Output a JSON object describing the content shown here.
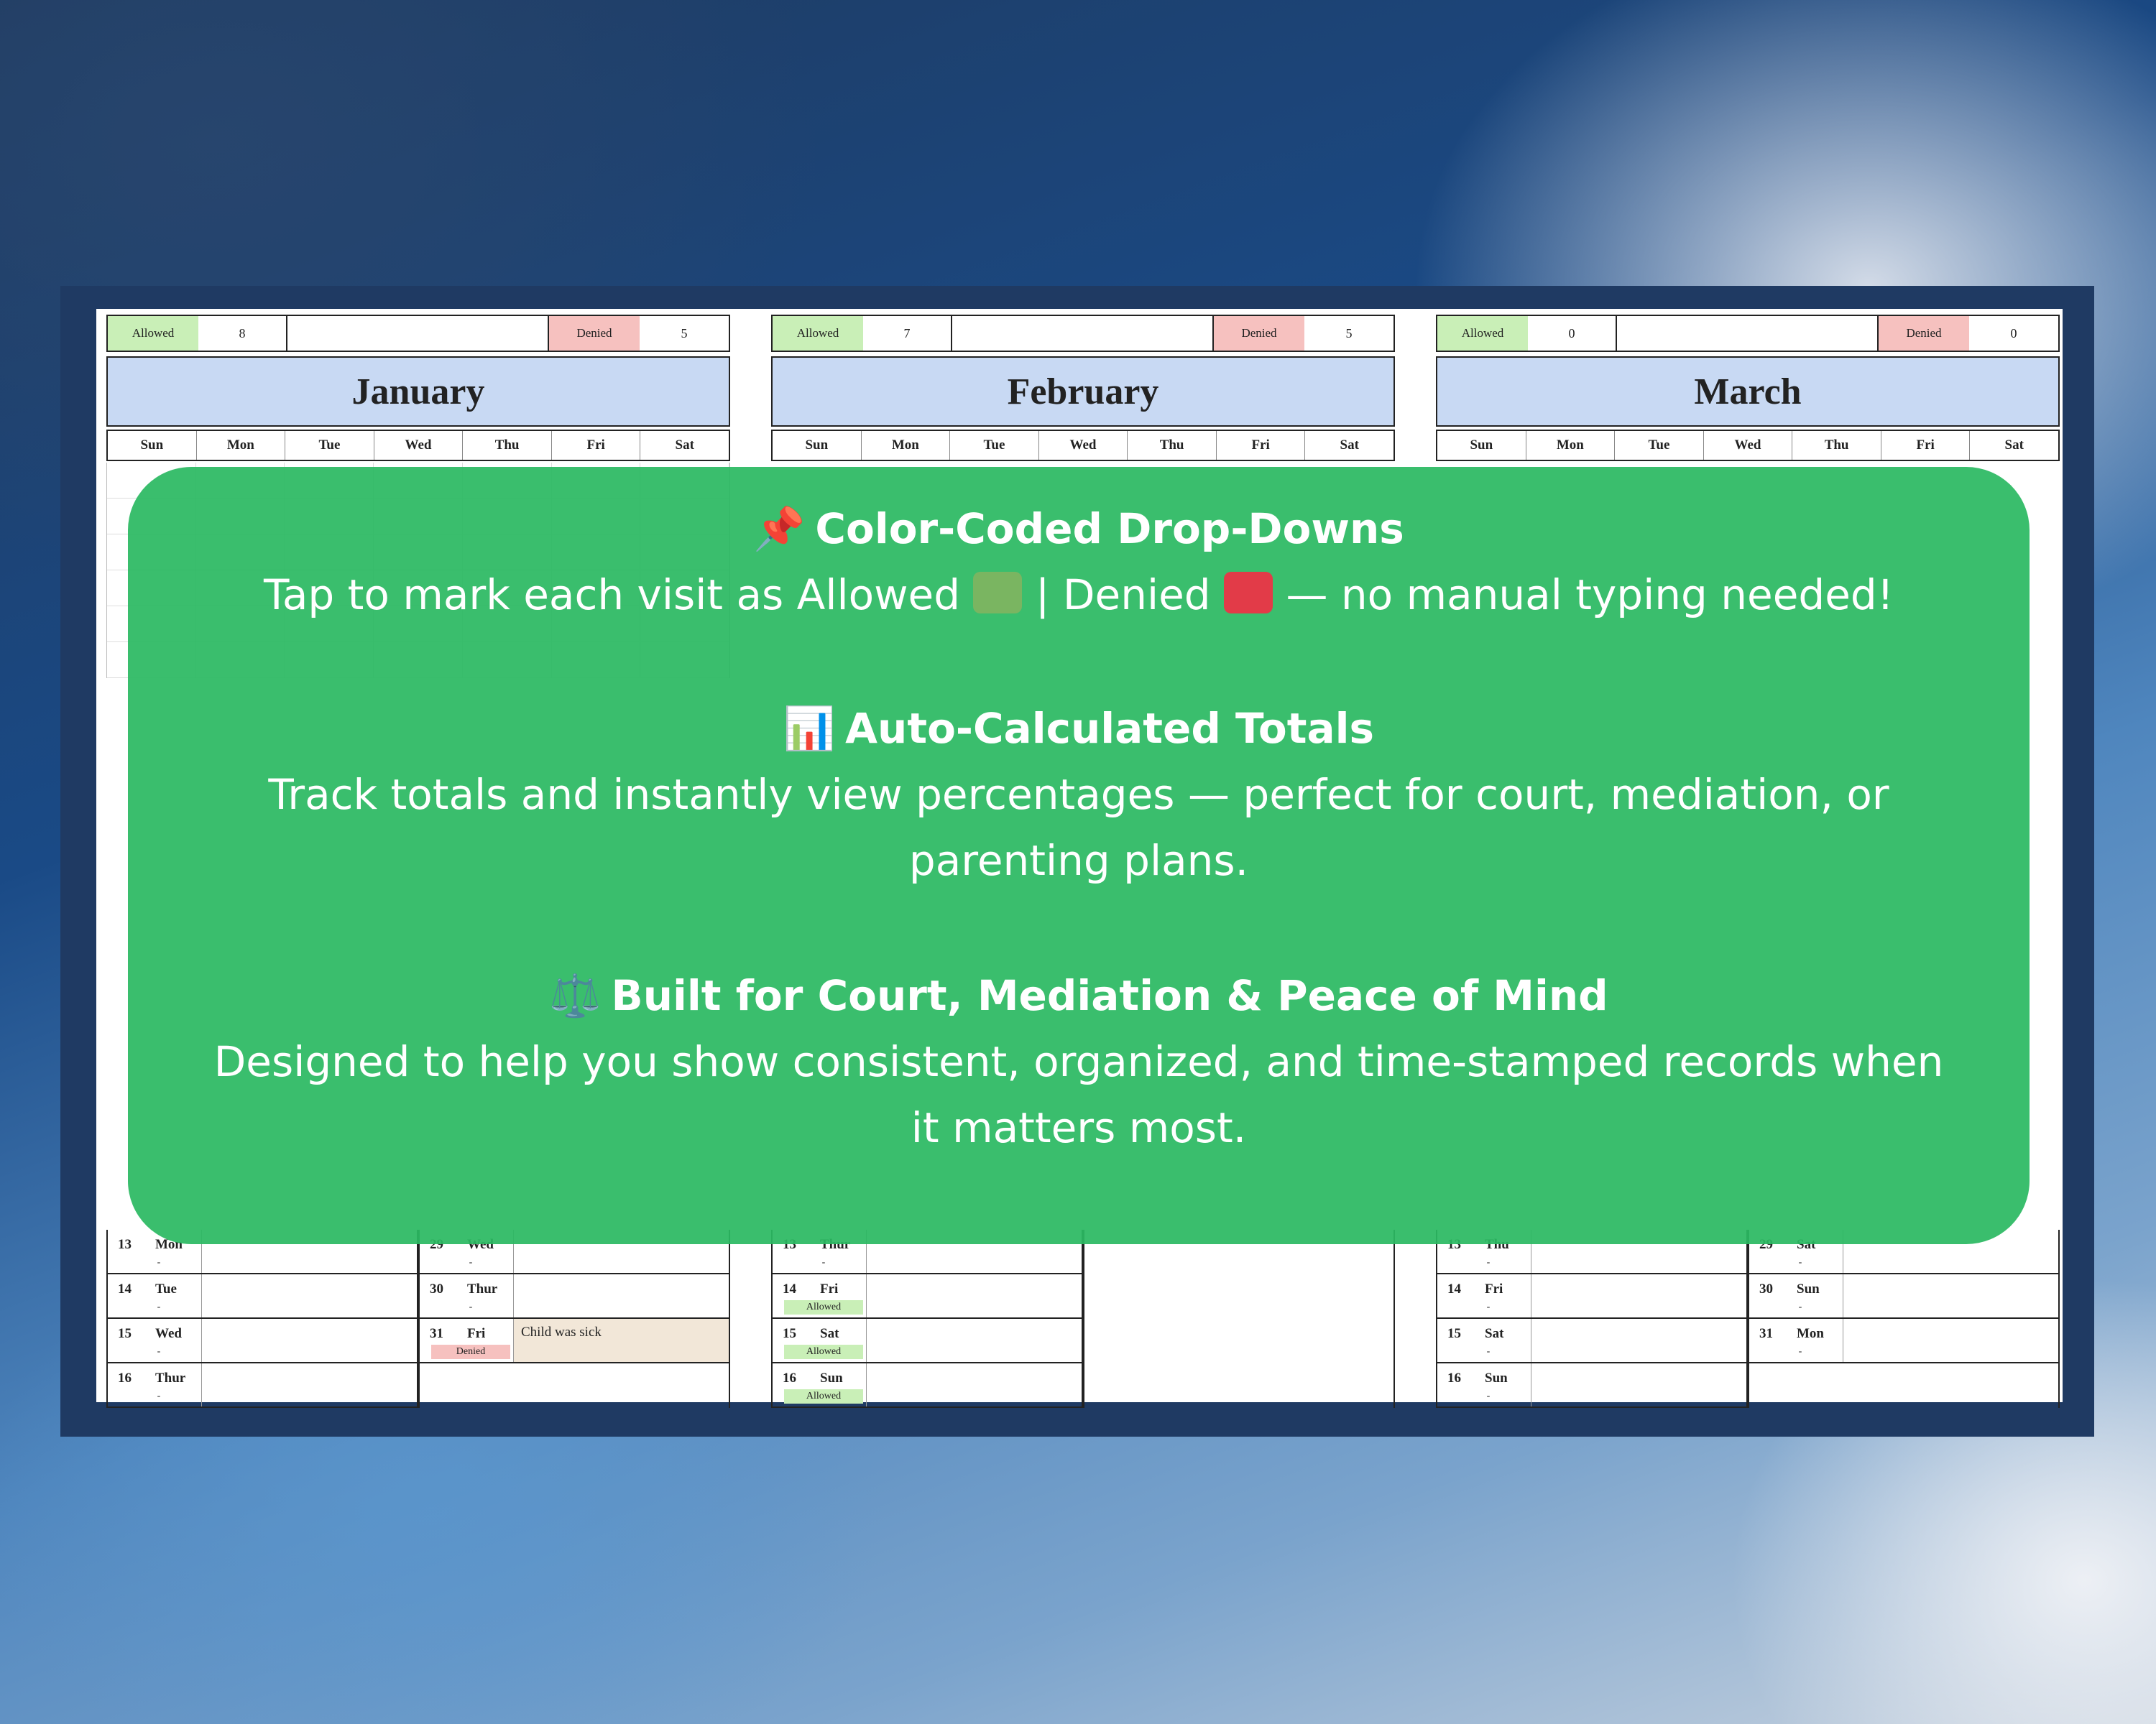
{
  "months": [
    {
      "name": "January",
      "allowed_label": "Allowed",
      "allowed_count": "8",
      "denied_label": "Denied",
      "denied_count": "5"
    },
    {
      "name": "February",
      "allowed_label": "Allowed",
      "allowed_count": "7",
      "denied_label": "Denied",
      "denied_count": "5"
    },
    {
      "name": "March",
      "allowed_label": "Allowed",
      "allowed_count": "0",
      "denied_label": "Denied",
      "denied_count": "0"
    }
  ],
  "weekdays": [
    "Sun",
    "Mon",
    "Tue",
    "Wed",
    "Thu",
    "Fri",
    "Sat"
  ],
  "january_log": [
    {
      "day": "13",
      "wd": "Mon",
      "status": "-"
    },
    {
      "day": "14",
      "wd": "Tue",
      "status": "-"
    },
    {
      "day": "15",
      "wd": "Wed",
      "status": "-"
    },
    {
      "day": "16",
      "wd": "Thur",
      "status": "-"
    }
  ],
  "january_log_right": [
    {
      "day": "29",
      "wd": "Wed",
      "status": "-"
    },
    {
      "day": "30",
      "wd": "Thur",
      "status": "-"
    },
    {
      "day": "31",
      "wd": "Fri",
      "status": "Denied",
      "note": "Child was sick"
    }
  ],
  "february_log": [
    {
      "day": "13",
      "wd": "Thur",
      "status": "-"
    },
    {
      "day": "14",
      "wd": "Fri",
      "status": "Allowed"
    },
    {
      "day": "15",
      "wd": "Sat",
      "status": "Allowed"
    },
    {
      "day": "16",
      "wd": "Sun",
      "status": "Allowed"
    }
  ],
  "march_log": [
    {
      "day": "13",
      "wd": "Thu",
      "status": "-"
    },
    {
      "day": "14",
      "wd": "Fri",
      "status": "-"
    },
    {
      "day": "15",
      "wd": "Sat",
      "status": "-"
    },
    {
      "day": "16",
      "wd": "Sun",
      "status": "-"
    }
  ],
  "march_log_right": [
    {
      "day": "29",
      "wd": "Sat",
      "status": "-"
    },
    {
      "day": "30",
      "wd": "Sun",
      "status": "-"
    },
    {
      "day": "31",
      "wd": "Mon",
      "status": "-"
    }
  ],
  "overlay": {
    "f1_title": "Color-Coded Drop-Downs",
    "f1_body_a": "Tap to mark each visit as Allowed",
    "f1_body_b": "| Denied",
    "f1_body_c": "— no manual typing needed!",
    "f2_title": "Auto-Calculated Totals",
    "f2_body": "Track totals and instantly view percentages — perfect for court, mediation, or parenting plans.",
    "f3_title": "Built for Court, Mediation & Peace of Mind",
    "f3_body": "Designed to help you show consistent, organized, and time-stamped records when it matters most.",
    "icons": [
      "pushpin-icon",
      "bar-chart-icon",
      "scales-icon"
    ],
    "swatch_allowed": "#7ab561",
    "swatch_denied": "#e23b48"
  }
}
